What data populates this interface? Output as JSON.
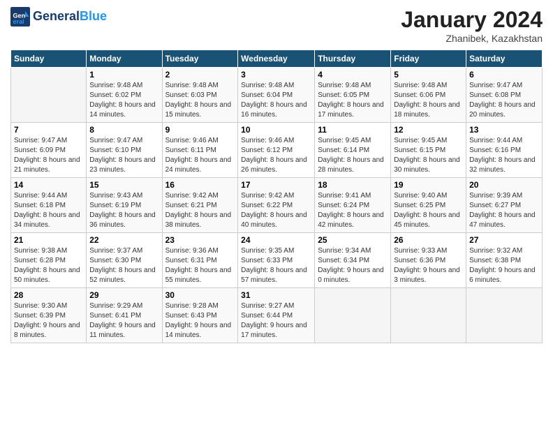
{
  "header": {
    "logo_line1": "General",
    "logo_line2": "Blue",
    "month_year": "January 2024",
    "location": "Zhanibek, Kazakhstan"
  },
  "days_of_week": [
    "Sunday",
    "Monday",
    "Tuesday",
    "Wednesday",
    "Thursday",
    "Friday",
    "Saturday"
  ],
  "weeks": [
    [
      {
        "day": "",
        "sunrise": "",
        "sunset": "",
        "daylight": ""
      },
      {
        "day": "1",
        "sunrise": "Sunrise: 9:48 AM",
        "sunset": "Sunset: 6:02 PM",
        "daylight": "Daylight: 8 hours and 14 minutes."
      },
      {
        "day": "2",
        "sunrise": "Sunrise: 9:48 AM",
        "sunset": "Sunset: 6:03 PM",
        "daylight": "Daylight: 8 hours and 15 minutes."
      },
      {
        "day": "3",
        "sunrise": "Sunrise: 9:48 AM",
        "sunset": "Sunset: 6:04 PM",
        "daylight": "Daylight: 8 hours and 16 minutes."
      },
      {
        "day": "4",
        "sunrise": "Sunrise: 9:48 AM",
        "sunset": "Sunset: 6:05 PM",
        "daylight": "Daylight: 8 hours and 17 minutes."
      },
      {
        "day": "5",
        "sunrise": "Sunrise: 9:48 AM",
        "sunset": "Sunset: 6:06 PM",
        "daylight": "Daylight: 8 hours and 18 minutes."
      },
      {
        "day": "6",
        "sunrise": "Sunrise: 9:47 AM",
        "sunset": "Sunset: 6:08 PM",
        "daylight": "Daylight: 8 hours and 20 minutes."
      }
    ],
    [
      {
        "day": "7",
        "sunrise": "Sunrise: 9:47 AM",
        "sunset": "Sunset: 6:09 PM",
        "daylight": "Daylight: 8 hours and 21 minutes."
      },
      {
        "day": "8",
        "sunrise": "Sunrise: 9:47 AM",
        "sunset": "Sunset: 6:10 PM",
        "daylight": "Daylight: 8 hours and 23 minutes."
      },
      {
        "day": "9",
        "sunrise": "Sunrise: 9:46 AM",
        "sunset": "Sunset: 6:11 PM",
        "daylight": "Daylight: 8 hours and 24 minutes."
      },
      {
        "day": "10",
        "sunrise": "Sunrise: 9:46 AM",
        "sunset": "Sunset: 6:12 PM",
        "daylight": "Daylight: 8 hours and 26 minutes."
      },
      {
        "day": "11",
        "sunrise": "Sunrise: 9:45 AM",
        "sunset": "Sunset: 6:14 PM",
        "daylight": "Daylight: 8 hours and 28 minutes."
      },
      {
        "day": "12",
        "sunrise": "Sunrise: 9:45 AM",
        "sunset": "Sunset: 6:15 PM",
        "daylight": "Daylight: 8 hours and 30 minutes."
      },
      {
        "day": "13",
        "sunrise": "Sunrise: 9:44 AM",
        "sunset": "Sunset: 6:16 PM",
        "daylight": "Daylight: 8 hours and 32 minutes."
      }
    ],
    [
      {
        "day": "14",
        "sunrise": "Sunrise: 9:44 AM",
        "sunset": "Sunset: 6:18 PM",
        "daylight": "Daylight: 8 hours and 34 minutes."
      },
      {
        "day": "15",
        "sunrise": "Sunrise: 9:43 AM",
        "sunset": "Sunset: 6:19 PM",
        "daylight": "Daylight: 8 hours and 36 minutes."
      },
      {
        "day": "16",
        "sunrise": "Sunrise: 9:42 AM",
        "sunset": "Sunset: 6:21 PM",
        "daylight": "Daylight: 8 hours and 38 minutes."
      },
      {
        "day": "17",
        "sunrise": "Sunrise: 9:42 AM",
        "sunset": "Sunset: 6:22 PM",
        "daylight": "Daylight: 8 hours and 40 minutes."
      },
      {
        "day": "18",
        "sunrise": "Sunrise: 9:41 AM",
        "sunset": "Sunset: 6:24 PM",
        "daylight": "Daylight: 8 hours and 42 minutes."
      },
      {
        "day": "19",
        "sunrise": "Sunrise: 9:40 AM",
        "sunset": "Sunset: 6:25 PM",
        "daylight": "Daylight: 8 hours and 45 minutes."
      },
      {
        "day": "20",
        "sunrise": "Sunrise: 9:39 AM",
        "sunset": "Sunset: 6:27 PM",
        "daylight": "Daylight: 8 hours and 47 minutes."
      }
    ],
    [
      {
        "day": "21",
        "sunrise": "Sunrise: 9:38 AM",
        "sunset": "Sunset: 6:28 PM",
        "daylight": "Daylight: 8 hours and 50 minutes."
      },
      {
        "day": "22",
        "sunrise": "Sunrise: 9:37 AM",
        "sunset": "Sunset: 6:30 PM",
        "daylight": "Daylight: 8 hours and 52 minutes."
      },
      {
        "day": "23",
        "sunrise": "Sunrise: 9:36 AM",
        "sunset": "Sunset: 6:31 PM",
        "daylight": "Daylight: 8 hours and 55 minutes."
      },
      {
        "day": "24",
        "sunrise": "Sunrise: 9:35 AM",
        "sunset": "Sunset: 6:33 PM",
        "daylight": "Daylight: 8 hours and 57 minutes."
      },
      {
        "day": "25",
        "sunrise": "Sunrise: 9:34 AM",
        "sunset": "Sunset: 6:34 PM",
        "daylight": "Daylight: 9 hours and 0 minutes."
      },
      {
        "day": "26",
        "sunrise": "Sunrise: 9:33 AM",
        "sunset": "Sunset: 6:36 PM",
        "daylight": "Daylight: 9 hours and 3 minutes."
      },
      {
        "day": "27",
        "sunrise": "Sunrise: 9:32 AM",
        "sunset": "Sunset: 6:38 PM",
        "daylight": "Daylight: 9 hours and 6 minutes."
      }
    ],
    [
      {
        "day": "28",
        "sunrise": "Sunrise: 9:30 AM",
        "sunset": "Sunset: 6:39 PM",
        "daylight": "Daylight: 9 hours and 8 minutes."
      },
      {
        "day": "29",
        "sunrise": "Sunrise: 9:29 AM",
        "sunset": "Sunset: 6:41 PM",
        "daylight": "Daylight: 9 hours and 11 minutes."
      },
      {
        "day": "30",
        "sunrise": "Sunrise: 9:28 AM",
        "sunset": "Sunset: 6:43 PM",
        "daylight": "Daylight: 9 hours and 14 minutes."
      },
      {
        "day": "31",
        "sunrise": "Sunrise: 9:27 AM",
        "sunset": "Sunset: 6:44 PM",
        "daylight": "Daylight: 9 hours and 17 minutes."
      },
      {
        "day": "",
        "sunrise": "",
        "sunset": "",
        "daylight": ""
      },
      {
        "day": "",
        "sunrise": "",
        "sunset": "",
        "daylight": ""
      },
      {
        "day": "",
        "sunrise": "",
        "sunset": "",
        "daylight": ""
      }
    ]
  ]
}
